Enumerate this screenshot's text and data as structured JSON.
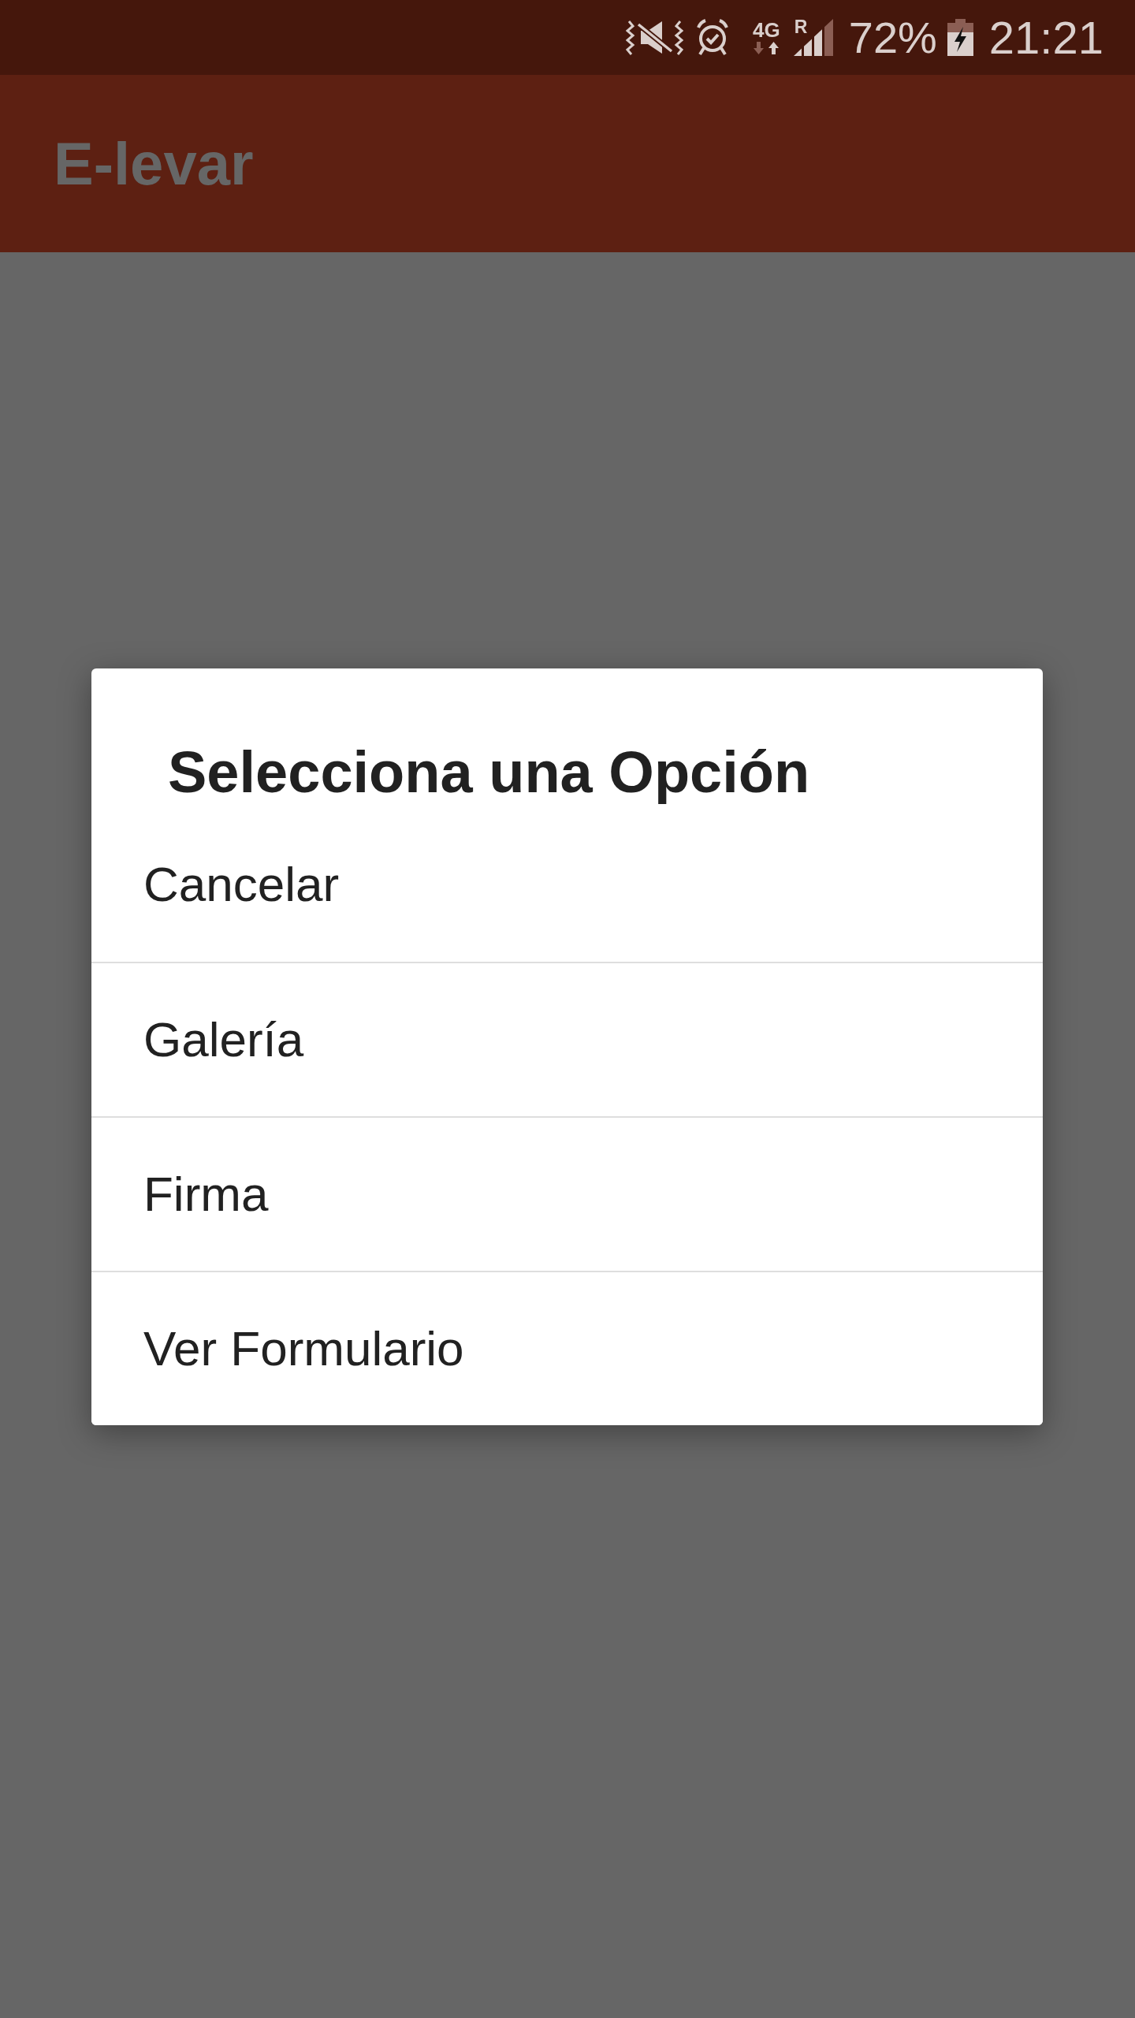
{
  "status_bar": {
    "network_type": "4G",
    "roaming": "R",
    "battery": "72%",
    "time": "21:21"
  },
  "app_bar": {
    "title": "E-levar"
  },
  "dialog": {
    "title": "Selecciona una Opción",
    "options": [
      {
        "label": "Cancelar"
      },
      {
        "label": "Galería"
      },
      {
        "label": "Firma"
      },
      {
        "label": "Ver Formulario"
      }
    ]
  }
}
